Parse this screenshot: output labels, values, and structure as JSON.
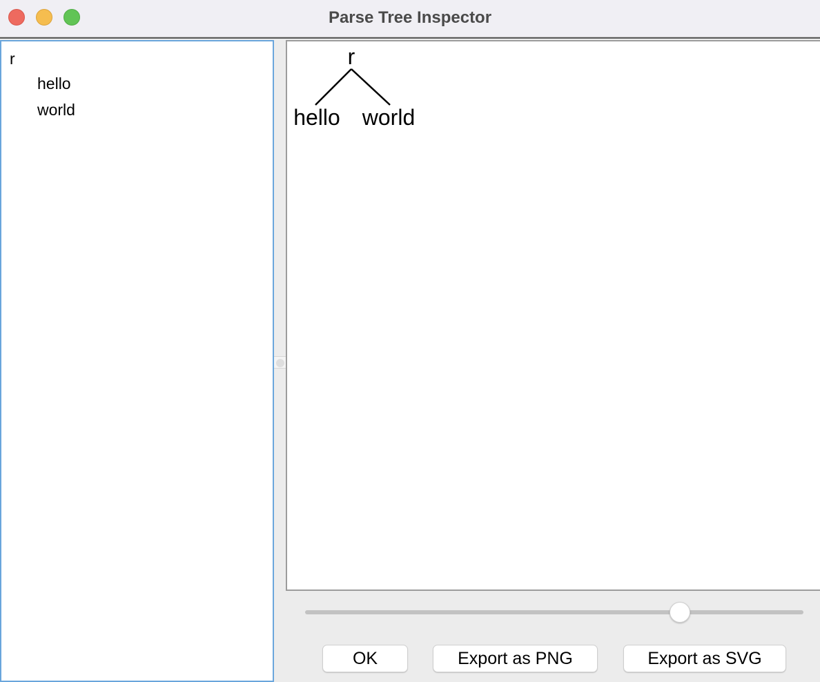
{
  "window": {
    "title": "Parse Tree Inspector"
  },
  "tree_view": {
    "root": "r",
    "children": [
      "hello",
      "world"
    ]
  },
  "tree_diagram": {
    "root": "r",
    "children": [
      "hello",
      "world"
    ]
  },
  "zoom_slider": {
    "value_fraction": 0.75
  },
  "buttons": {
    "ok": "OK",
    "export_png": "Export as PNG",
    "export_svg": "Export as SVG"
  }
}
